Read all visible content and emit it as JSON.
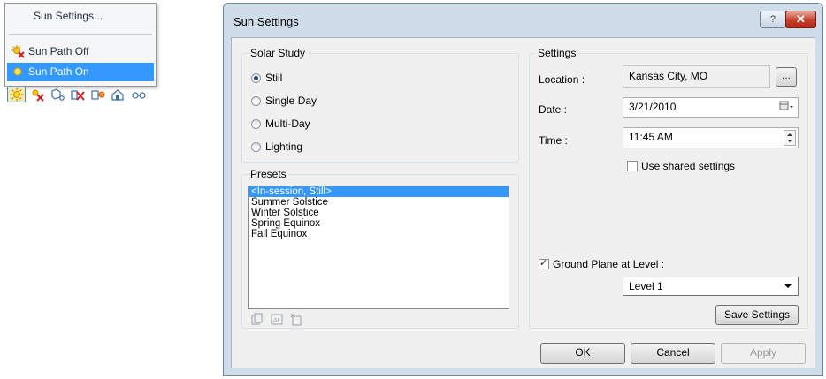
{
  "context_menu": {
    "items": [
      {
        "label": "Sun Settings...",
        "icon": ""
      },
      {
        "label": "Sun Path Off",
        "icon": "sun-off-icon"
      },
      {
        "label": "Sun Path On",
        "icon": "sun-on-icon",
        "selected": true
      }
    ]
  },
  "toolbar": {
    "icons": [
      "sun-icon",
      "sun-off-icon",
      "shadow-icon",
      "shadows-off-icon",
      "render-icon",
      "house-icon",
      "glasses-icon"
    ]
  },
  "dialog": {
    "title": "Sun Settings",
    "help_label": "?",
    "close_label": "✕",
    "solar_study": {
      "legend": "Solar Study",
      "options": [
        "Still",
        "Single Day",
        "Multi-Day",
        "Lighting"
      ],
      "selected": "Still"
    },
    "presets": {
      "legend": "Presets",
      "items": [
        "<In-session, Still>",
        "Summer Solstice",
        "Winter Solstice",
        "Spring Equinox",
        "Fall Equinox"
      ],
      "selected_index": 0,
      "icons": [
        "duplicate-icon",
        "rename-icon",
        "delete-icon"
      ]
    },
    "settings": {
      "legend": "Settings",
      "location_label": "Location :",
      "location_value": "Kansas City, MO",
      "browse_label": "...",
      "date_label": "Date :",
      "date_value": "3/21/2010",
      "time_label": "Time :",
      "time_value": "11:45 AM",
      "use_shared_label": "Use shared settings",
      "use_shared_checked": false,
      "ground_plane_label": "Ground Plane at Level :",
      "ground_plane_checked": true,
      "level_value": "Level 1",
      "save_label": "Save Settings"
    },
    "buttons": {
      "ok": "OK",
      "cancel": "Cancel",
      "apply": "Apply"
    }
  }
}
